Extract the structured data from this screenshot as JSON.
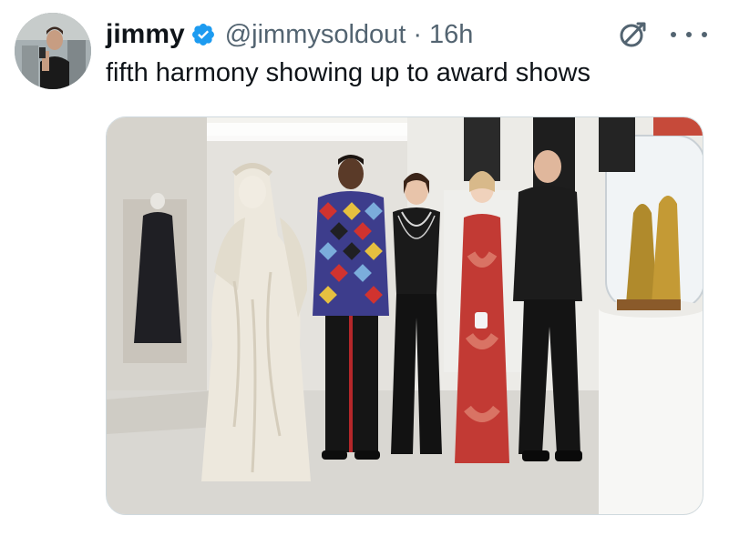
{
  "tweet": {
    "author_name": "jimmy",
    "verified_icon": "verified-badge-icon",
    "handle": "@jimmysoldout",
    "separator": "·",
    "time": "16h",
    "text": "fifth harmony showing up to award shows",
    "grok_icon": "grok-icon",
    "more_icon": "more-options-icon",
    "colors": {
      "verified": "#1d9bf0",
      "secondary_text": "#536471",
      "primary_text": "#0f1419"
    }
  }
}
